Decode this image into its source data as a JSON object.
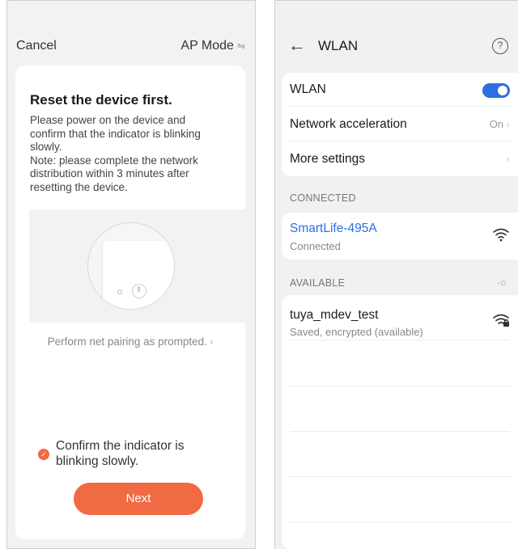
{
  "left": {
    "cancel_label": "Cancel",
    "ap_mode_label": "AP Mode",
    "title": "Reset the device first.",
    "description": "Please power on the device and confirm that the indicator is blinking slowly.\nNote: please complete the network distribution within 3 minutes after resetting the device.",
    "pairing_link": "Perform net pairing as prompted.",
    "confirm_text": "Confirm the indicator is blinking slowly.",
    "next_label": "Next",
    "accent_color": "#f06a44"
  },
  "right": {
    "title": "WLAN",
    "settings": [
      {
        "label": "WLAN",
        "value": "",
        "toggle": true
      },
      {
        "label": "Network acceleration",
        "value": "On"
      },
      {
        "label": "More settings",
        "value": ""
      }
    ],
    "connected_header": "CONNECTED",
    "connected_network": {
      "name": "SmartLife-495A",
      "status": "Connected"
    },
    "available_header": "AVAILABLE",
    "available_networks": [
      {
        "name": "tuya_mdev_test",
        "status": "Saved, encrypted (available)"
      }
    ],
    "accent_color": "#2b6fe0"
  }
}
